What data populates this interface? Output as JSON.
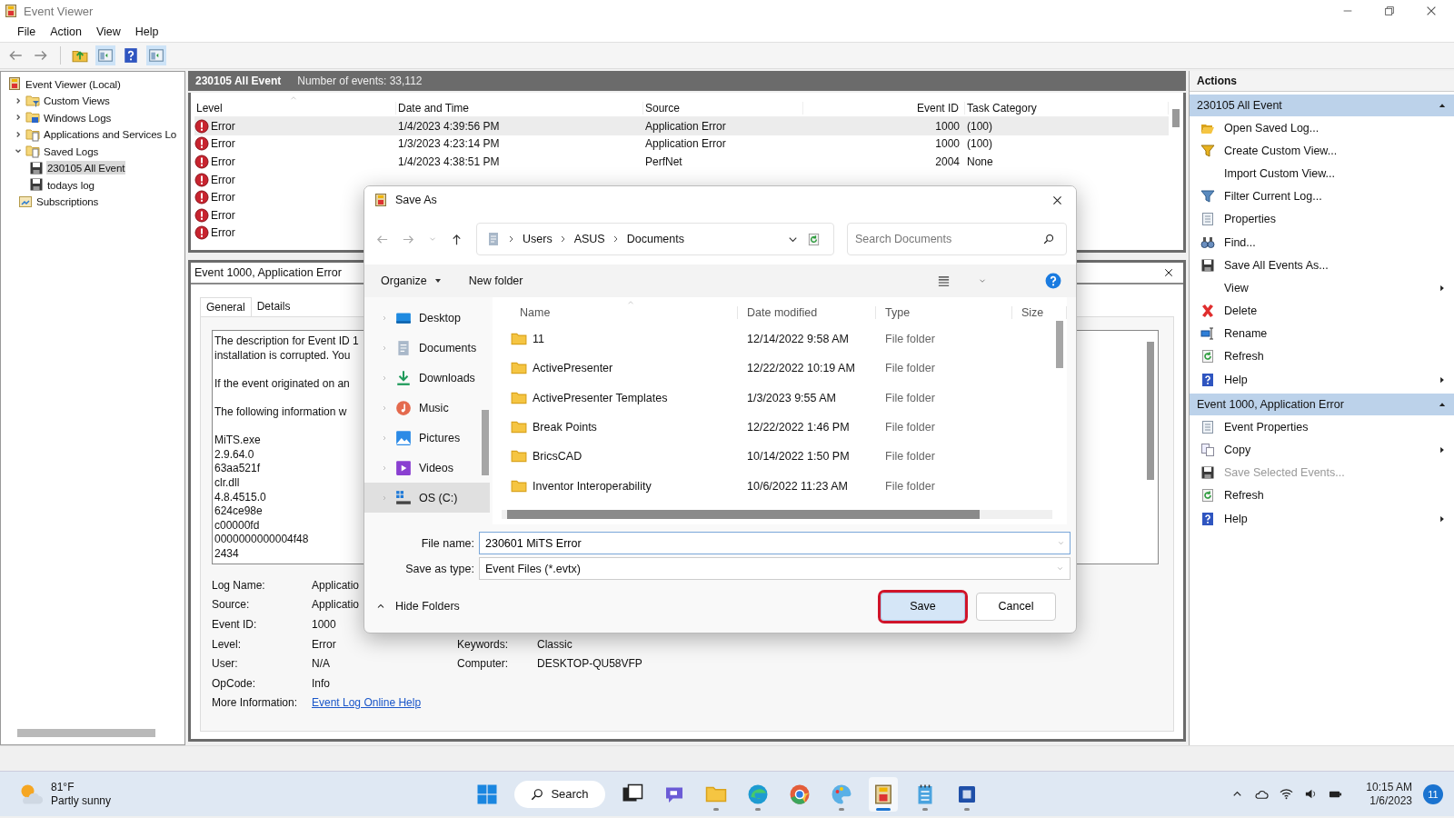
{
  "window": {
    "title": "Event Viewer"
  },
  "menu": [
    "File",
    "Action",
    "View",
    "Help"
  ],
  "tree": [
    {
      "label": "Event Viewer (Local)",
      "kind": "viewer",
      "selected": false,
      "children": [
        {
          "label": "Custom Views",
          "kind": "folder-filter",
          "expanded": false,
          "selected": false
        },
        {
          "label": "Windows Logs",
          "kind": "folder-win",
          "expanded": false,
          "selected": false
        },
        {
          "label": "Applications and Services Lo",
          "kind": "folder-doc",
          "expanded": false,
          "selected": false
        },
        {
          "label": "Saved Logs",
          "kind": "folder-doc",
          "expanded": true,
          "selected": false,
          "children": [
            {
              "label": "230105 All Event",
              "kind": "disk",
              "selected": true
            },
            {
              "label": "todays log",
              "kind": "disk",
              "selected": false
            }
          ]
        },
        {
          "label": "Subscriptions",
          "kind": "subscriptions",
          "selected": false
        }
      ]
    }
  ],
  "log": {
    "name": "230105 All Event",
    "count": "Number of events: 33,112",
    "columns": [
      "Level",
      "Date and Time",
      "Source",
      "Event ID",
      "Task Category"
    ],
    "rows": [
      {
        "level": "Error",
        "date": "1/4/2023 4:39:56 PM",
        "source": "Application Error",
        "id": "1000",
        "category": "(100)",
        "selected": true
      },
      {
        "level": "Error",
        "date": "1/3/2023 4:23:14 PM",
        "source": "Application Error",
        "id": "1000",
        "category": "(100)",
        "selected": false
      },
      {
        "level": "Error",
        "date": "1/4/2023 4:38:51 PM",
        "source": "PerfNet",
        "id": "2004",
        "category": "None",
        "selected": false
      },
      {
        "level": "Error",
        "selected": false
      },
      {
        "level": "Error",
        "selected": false
      },
      {
        "level": "Error",
        "selected": false
      },
      {
        "level": "Error",
        "selected": false
      }
    ]
  },
  "event": {
    "title": "Event 1000, Application Error",
    "tabs": [
      {
        "label": "General",
        "selected": true
      },
      {
        "label": "Details",
        "selected": false
      }
    ],
    "description": [
      [
        "The description for Event ID 1",
        "installation is corrupted. You"
      ],
      [
        "If the event originated on an"
      ],
      [
        "The following information w"
      ],
      [
        "MiTS.exe",
        "2.9.64.0",
        "63aa521f",
        "clr.dll",
        "4.8.4515.0",
        "624ce98e",
        "c00000fd",
        "0000000000004f48",
        "2434"
      ]
    ],
    "fields": [
      [
        {
          "label": "Log Name:",
          "value": "Applicatio"
        }
      ],
      [
        {
          "label": "Source:",
          "value": "Applicatio"
        }
      ],
      [
        {
          "label": "Event ID:",
          "value": "1000"
        }
      ],
      [
        {
          "label": "Level:",
          "value": "Error"
        },
        {
          "label": "Keywords:",
          "value": "Classic"
        }
      ],
      [
        {
          "label": "User:",
          "value": "N/A"
        },
        {
          "label": "Computer:",
          "value": "DESKTOP-QU58VFP"
        }
      ],
      [
        {
          "label": "OpCode:",
          "value": "Info"
        }
      ],
      [
        {
          "label": "More Information:",
          "value": "Event Log Online Help",
          "kind": "link"
        }
      ]
    ]
  },
  "actions": {
    "title": "Actions",
    "sections": [
      {
        "title": "230105 All Event",
        "expanded": true,
        "items": [
          {
            "label": "Open Saved Log...",
            "kind": "open",
            "submenu": false,
            "disabled": false
          },
          {
            "label": "Create Custom View...",
            "kind": "filter-new",
            "submenu": false,
            "disabled": false
          },
          {
            "label": "Import Custom View...",
            "kind": "none",
            "submenu": false,
            "disabled": false
          },
          {
            "label": "Filter Current Log...",
            "kind": "filter",
            "submenu": false,
            "disabled": false
          },
          {
            "label": "Properties",
            "kind": "properties",
            "submenu": false,
            "disabled": false
          },
          {
            "label": "Find...",
            "kind": "find",
            "submenu": false,
            "disabled": false
          },
          {
            "label": "Save All Events As...",
            "kind": "save",
            "submenu": false,
            "disabled": false
          },
          {
            "label": "View",
            "kind": "none",
            "submenu": true,
            "disabled": false
          },
          {
            "label": "Delete",
            "kind": "delete",
            "submenu": false,
            "disabled": false
          },
          {
            "label": "Rename",
            "kind": "rename",
            "submenu": false,
            "disabled": false
          },
          {
            "label": "Refresh",
            "kind": "refresh",
            "submenu": false,
            "disabled": false
          },
          {
            "label": "Help",
            "kind": "help",
            "submenu": true,
            "disabled": false
          }
        ]
      },
      {
        "title": "Event 1000, Application Error",
        "expanded": true,
        "items": [
          {
            "label": "Event Properties",
            "kind": "properties",
            "submenu": false,
            "disabled": false
          },
          {
            "label": "Copy",
            "kind": "copy",
            "submenu": true,
            "disabled": false
          },
          {
            "label": "Save Selected Events...",
            "kind": "save",
            "submenu": false,
            "disabled": true
          },
          {
            "label": "Refresh",
            "kind": "refresh",
            "submenu": false,
            "disabled": false
          },
          {
            "label": "Help",
            "kind": "help",
            "submenu": true,
            "disabled": false
          }
        ]
      }
    ]
  },
  "dialog": {
    "title": "Save As",
    "breadcrumb": [
      "Users",
      "ASUS",
      "Documents"
    ],
    "search": {
      "placeholder": "Search Documents"
    },
    "commands": [
      "Organize",
      "New folder"
    ],
    "places": [
      {
        "label": "Desktop",
        "kind": "desktop",
        "selected": false
      },
      {
        "label": "Documents",
        "kind": "documents",
        "selected": false
      },
      {
        "label": "Downloads",
        "kind": "downloads",
        "selected": false
      },
      {
        "label": "Music",
        "kind": "music",
        "selected": false
      },
      {
        "label": "Pictures",
        "kind": "pictures",
        "selected": false
      },
      {
        "label": "Videos",
        "kind": "videos",
        "selected": false
      },
      {
        "label": "OS (C:)",
        "kind": "drive",
        "selected": true
      }
    ],
    "columns": [
      "Name",
      "Date modified",
      "Type",
      "Size"
    ],
    "files": [
      {
        "name": "11",
        "modified": "12/14/2022 9:58 AM",
        "type": "File folder"
      },
      {
        "name": "ActivePresenter",
        "modified": "12/22/2022 10:19 AM",
        "type": "File folder"
      },
      {
        "name": "ActivePresenter Templates",
        "modified": "1/3/2023 9:55 AM",
        "type": "File folder"
      },
      {
        "name": "Break Points",
        "modified": "12/22/2022 1:46 PM",
        "type": "File folder"
      },
      {
        "name": "BricsCAD",
        "modified": "10/14/2022 1:50 PM",
        "type": "File folder"
      },
      {
        "name": "Inventor Interoperability",
        "modified": "10/6/2022 11:23 AM",
        "type": "File folder"
      }
    ],
    "file_name": {
      "label": "File name:",
      "value": "230601 MiTS Error"
    },
    "file_type": {
      "label": "Save as type:",
      "value": "Event Files (*.evtx)"
    },
    "hide_folders": "Hide Folders",
    "buttons": [
      {
        "label": "Save",
        "primary": true,
        "highlighted": true
      },
      {
        "label": "Cancel",
        "primary": false,
        "highlighted": false
      }
    ]
  },
  "taskbar": {
    "temperature": "81°F",
    "weather": "Partly sunny",
    "search": "Search",
    "apps": [
      {
        "kind": "taskview",
        "running": false,
        "active": false
      },
      {
        "kind": "chat",
        "running": false,
        "active": false
      },
      {
        "kind": "explorer",
        "running": true,
        "active": false
      },
      {
        "kind": "edge",
        "running": true,
        "active": false
      },
      {
        "kind": "chrome",
        "running": false,
        "active": false
      },
      {
        "kind": "paint",
        "running": true,
        "active": false
      },
      {
        "kind": "eventviewer",
        "running": true,
        "active": true
      },
      {
        "kind": "notepad",
        "running": true,
        "active": false
      },
      {
        "kind": "word",
        "running": true,
        "active": false
      }
    ],
    "time": "10:15 AM",
    "date": "1/6/2023",
    "notifications": "11"
  }
}
